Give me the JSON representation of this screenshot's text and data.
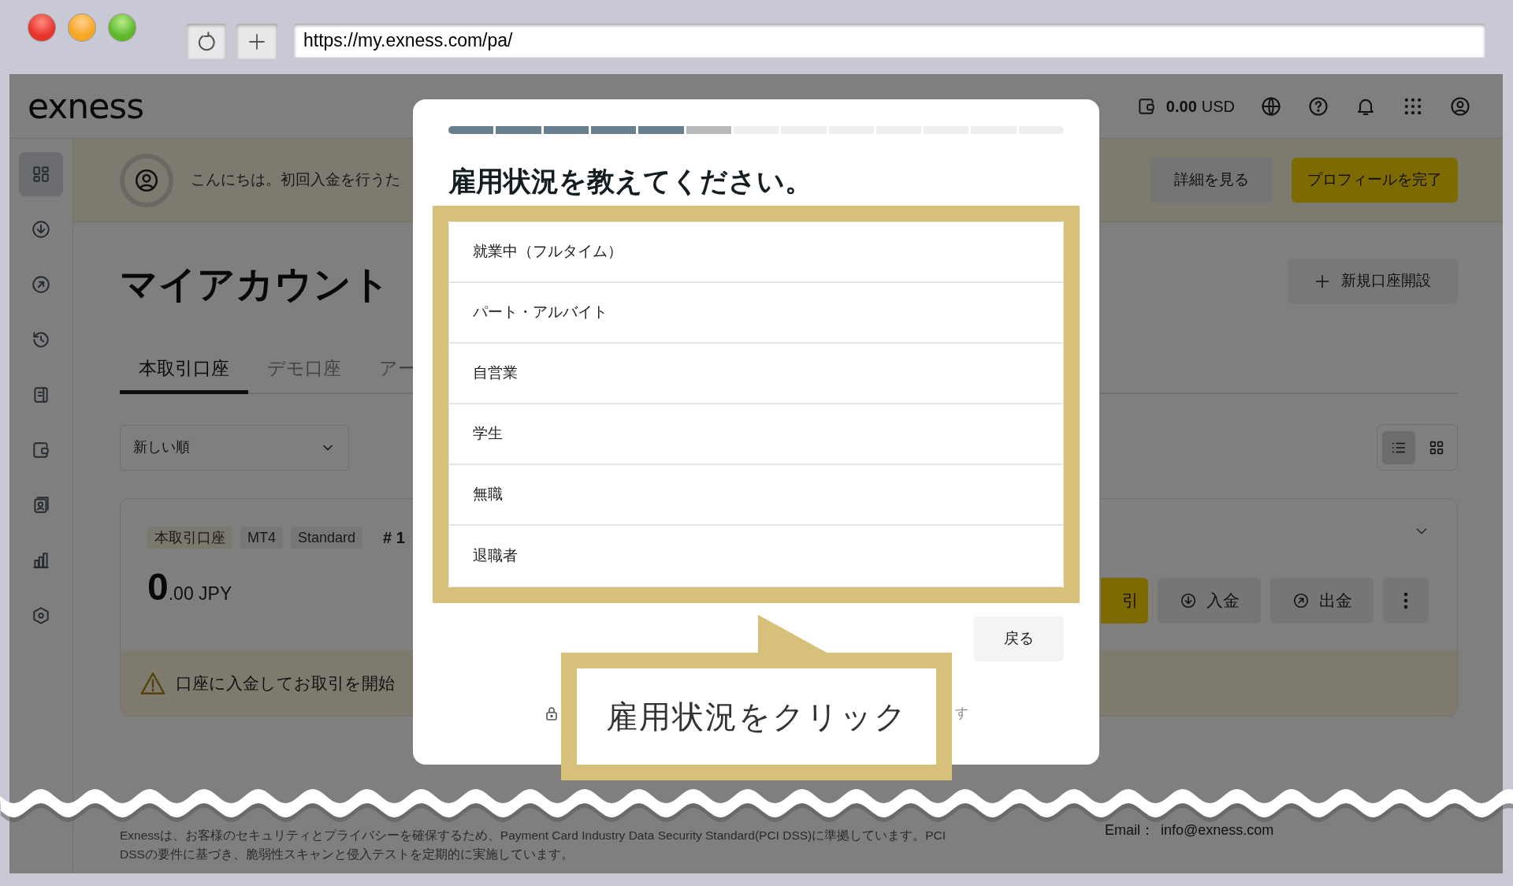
{
  "browser": {
    "url": "https://my.exness.com/pa/"
  },
  "header": {
    "logo": "exness",
    "balance": {
      "amount": "0.00",
      "currency": "USD"
    }
  },
  "sidebar": {
    "items": [
      {
        "kind": "dashboard",
        "selected": true
      },
      {
        "kind": "deposit",
        "selected": false
      },
      {
        "kind": "withdraw",
        "selected": false
      },
      {
        "kind": "history",
        "selected": false
      },
      {
        "kind": "reports",
        "selected": false
      },
      {
        "kind": "wallet",
        "selected": false
      },
      {
        "kind": "profile",
        "selected": false
      },
      {
        "kind": "analytics",
        "selected": false
      },
      {
        "kind": "settings",
        "selected": false
      }
    ]
  },
  "banner": {
    "greeting": "こんにちは。初回入金を行うた",
    "buttons": [
      {
        "label": "詳細を見る",
        "kind": "secondary"
      },
      {
        "label": "プロフィールを完了",
        "kind": "primary"
      }
    ]
  },
  "page": {
    "title": "マイアカウント",
    "new_account_button": "新規口座開設",
    "tabs": [
      {
        "label": "本取引口座",
        "selected": true
      },
      {
        "label": "デモ口座",
        "selected": false
      },
      {
        "label": "アー",
        "selected": false
      }
    ],
    "sort": "新しい順",
    "view_toggle": [
      {
        "kind": "list",
        "selected": true
      },
      {
        "kind": "grid",
        "selected": false
      }
    ]
  },
  "account": {
    "tags": [
      "本取引口座",
      "MT4",
      "Standard"
    ],
    "number": "# 1",
    "balance_whole": "0",
    "balance_rest": ".00 JPY",
    "buttons": [
      {
        "kind": "trade",
        "label": "引"
      },
      {
        "kind": "deposit",
        "label": "入金"
      },
      {
        "kind": "withdraw",
        "label": "出金"
      },
      {
        "kind": "more"
      }
    ],
    "warning": "口座に入金してお取引を開始"
  },
  "modal": {
    "steps": [
      {
        "done": true,
        "current": false
      },
      {
        "done": true,
        "current": false
      },
      {
        "done": true,
        "current": false
      },
      {
        "done": true,
        "current": false
      },
      {
        "done": true,
        "current": false
      },
      {
        "done": false,
        "current": true
      },
      {
        "done": false,
        "current": false
      },
      {
        "done": false,
        "current": false
      },
      {
        "done": false,
        "current": false
      },
      {
        "done": false,
        "current": false
      },
      {
        "done": false,
        "current": false
      },
      {
        "done": false,
        "current": false
      },
      {
        "done": false,
        "current": false
      }
    ],
    "title": "雇用状況を教えてください。",
    "options": [
      "就業中（フルタイム）",
      "パート・アルバイト",
      "自営業",
      "学生",
      "無職",
      "退職者"
    ],
    "back_button": "戻る",
    "note": "す"
  },
  "callout": {
    "text": "雇用状況をクリック"
  },
  "footer": {
    "notice": "Exnessは、お客様のセキュリティとプライバシーを確保するため、Payment Card Industry Data Security Standard(PCI DSS)に準拠しています。PCI DSSの要件に基づき、脆弱性スキャンと侵入テストを定期的に実施しています。",
    "email_label": "Email：",
    "email": "info@exness.com"
  }
}
